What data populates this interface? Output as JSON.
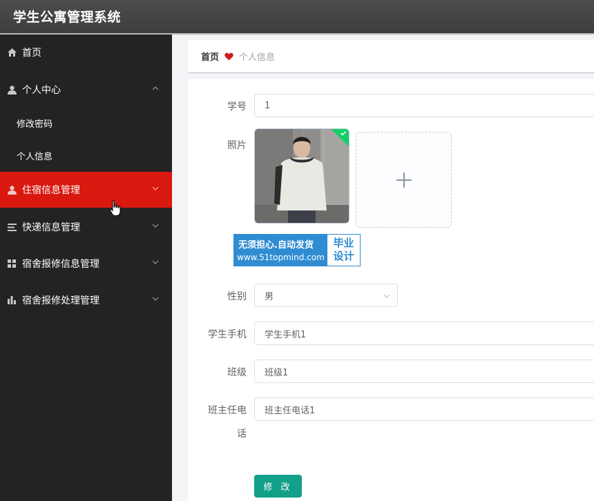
{
  "app": {
    "title": "学生公寓管理系统"
  },
  "sidebar": {
    "items": [
      {
        "label": "首页",
        "icon": "home-icon"
      },
      {
        "label": "个人中心",
        "icon": "user-icon",
        "expanded": true
      },
      {
        "label": "住宿信息管理",
        "icon": "user-icon",
        "active": true
      },
      {
        "label": "快递信息管理",
        "icon": "list-icon"
      },
      {
        "label": "宿舍报修信息管理",
        "icon": "grid-icon"
      },
      {
        "label": "宿舍报修处理管理",
        "icon": "bar-chart-icon"
      }
    ],
    "submenu": [
      {
        "label": "修改密码"
      },
      {
        "label": "个人信息"
      }
    ],
    "active_color": "#d9180f",
    "background": "#232323"
  },
  "breadcrumb": {
    "home": "首页",
    "current": "个人信息",
    "separator_icon": "heart-icon",
    "separator_color": "#c81e1e"
  },
  "form": {
    "student_id": {
      "label": "学号",
      "value": "1"
    },
    "photo": {
      "label": "照片",
      "upload_icon": "plus-icon"
    },
    "gender": {
      "label": "性别",
      "value": "男"
    },
    "phone": {
      "label": "学生手机",
      "value": "学生手机1"
    },
    "class": {
      "label": "班级",
      "value": "班级1"
    },
    "teacher_phone": {
      "label_line1": "班主任电",
      "label_line2": "话",
      "value": "班主任电话1"
    },
    "submit_label": "修 改",
    "submit_color": "#13a08a"
  },
  "watermark": {
    "line1": "无须担心.自动发货",
    "line2": "www.51topmind.com",
    "right_line1": "毕业",
    "right_line2": "设计"
  }
}
